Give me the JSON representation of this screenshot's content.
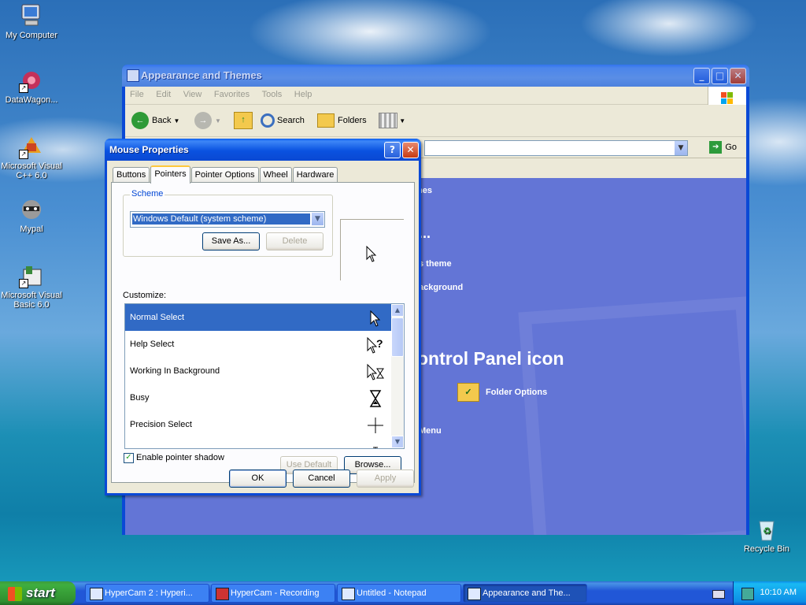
{
  "desktop": {
    "icons": [
      {
        "label": "My Computer"
      },
      {
        "label": "DataWagon..."
      },
      {
        "label": "Microsoft Visual C++ 6.0"
      },
      {
        "label": "Mypal"
      },
      {
        "label": "Microsoft Visual Basic 6.0"
      },
      {
        "label": "Recycle Bin"
      }
    ]
  },
  "explorer": {
    "title": "Appearance and Themes",
    "menu": [
      "File",
      "Edit",
      "View",
      "Favorites",
      "Tools",
      "Help"
    ],
    "toolbar": {
      "back": "Back",
      "search": "Search",
      "folders": "Folders"
    },
    "address": {
      "go": "Go"
    },
    "content": {
      "header_fragment": "mes",
      "task_dots": "...",
      "task1": "s theme",
      "task2": "ackground",
      "task3": ".",
      "cp_heading": "ontrol Panel icon",
      "folder_options": "Folder Options",
      "menu_fragment": "Menu"
    }
  },
  "dialog": {
    "title": "Mouse Properties",
    "tabs": [
      "Buttons",
      "Pointers",
      "Pointer Options",
      "Wheel",
      "Hardware"
    ],
    "active_tab": "Pointers",
    "scheme": {
      "label": "Scheme",
      "selected": "Windows Default (system scheme)",
      "save_as": "Save As...",
      "delete": "Delete"
    },
    "customize_label": "Customize:",
    "pointers": [
      {
        "name": "Normal Select",
        "icon": "arrow-cursor-icon"
      },
      {
        "name": "Help Select",
        "icon": "help-cursor-icon"
      },
      {
        "name": "Working In Background",
        "icon": "working-cursor-icon"
      },
      {
        "name": "Busy",
        "icon": "hourglass-icon"
      },
      {
        "name": "Precision Select",
        "icon": "crosshair-icon"
      }
    ],
    "selected_pointer": "Normal Select",
    "enable_shadow": {
      "label": "Enable pointer shadow",
      "checked": true
    },
    "use_default": "Use Default",
    "browse": "Browse...",
    "ok": "OK",
    "cancel": "Cancel",
    "apply": "Apply"
  },
  "taskbar": {
    "start": "start",
    "tasks": [
      {
        "label": "HyperCam 2 : Hyperi..."
      },
      {
        "label": "HyperCam - Recording"
      },
      {
        "label": "Untitled - Notepad"
      },
      {
        "label": "Appearance and The..."
      }
    ],
    "clock": "10:10 AM"
  }
}
